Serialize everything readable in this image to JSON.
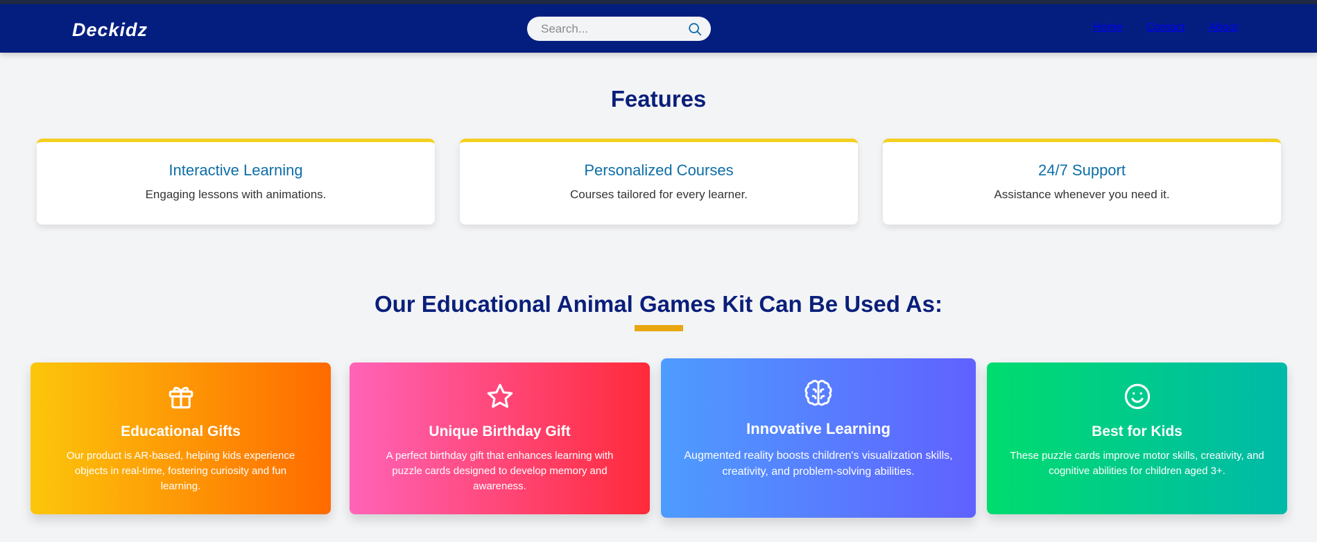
{
  "navbar": {
    "brand": "Deckidz",
    "search_placeholder": "Search...",
    "search_icon": "search-icon",
    "links": [
      "Home",
      "Contact",
      "About"
    ]
  },
  "features": {
    "title": "Features",
    "cards": [
      {
        "title": "Interactive Learning",
        "description": "Engaging lessons with animations."
      },
      {
        "title": "Personalized Courses",
        "description": "Courses tailored for every learner."
      },
      {
        "title": "24/7 Support",
        "description": "Assistance whenever you need it."
      }
    ]
  },
  "kit": {
    "title": "Our Educational Animal Games Kit Can Be Used As:",
    "cards": [
      {
        "icon": "gift-icon",
        "title": "Educational Gifts",
        "description": "Our product is AR-based, helping kids experience objects in real-time, fostering curiosity and fun learning."
      },
      {
        "icon": "star-icon",
        "title": "Unique Birthday Gift",
        "description": "A perfect birthday gift that enhances learning with puzzle cards designed to develop memory and awareness."
      },
      {
        "icon": "brain-icon",
        "title": "Innovative Learning",
        "description": "Augmented reality boosts children's visualization skills, creativity, and problem-solving abilities."
      },
      {
        "icon": "smile-icon",
        "title": "Best for Kids",
        "description": "These puzzle cards improve motor skills, creativity, and cognitive abilities for children aged 3+."
      }
    ]
  },
  "colors": {
    "navbar": "#041e80",
    "heading": "#0a1f7a",
    "accent_yellow": "#f5cf1f",
    "underline": "#e8a611",
    "feature_title": "#0c6ea8"
  }
}
